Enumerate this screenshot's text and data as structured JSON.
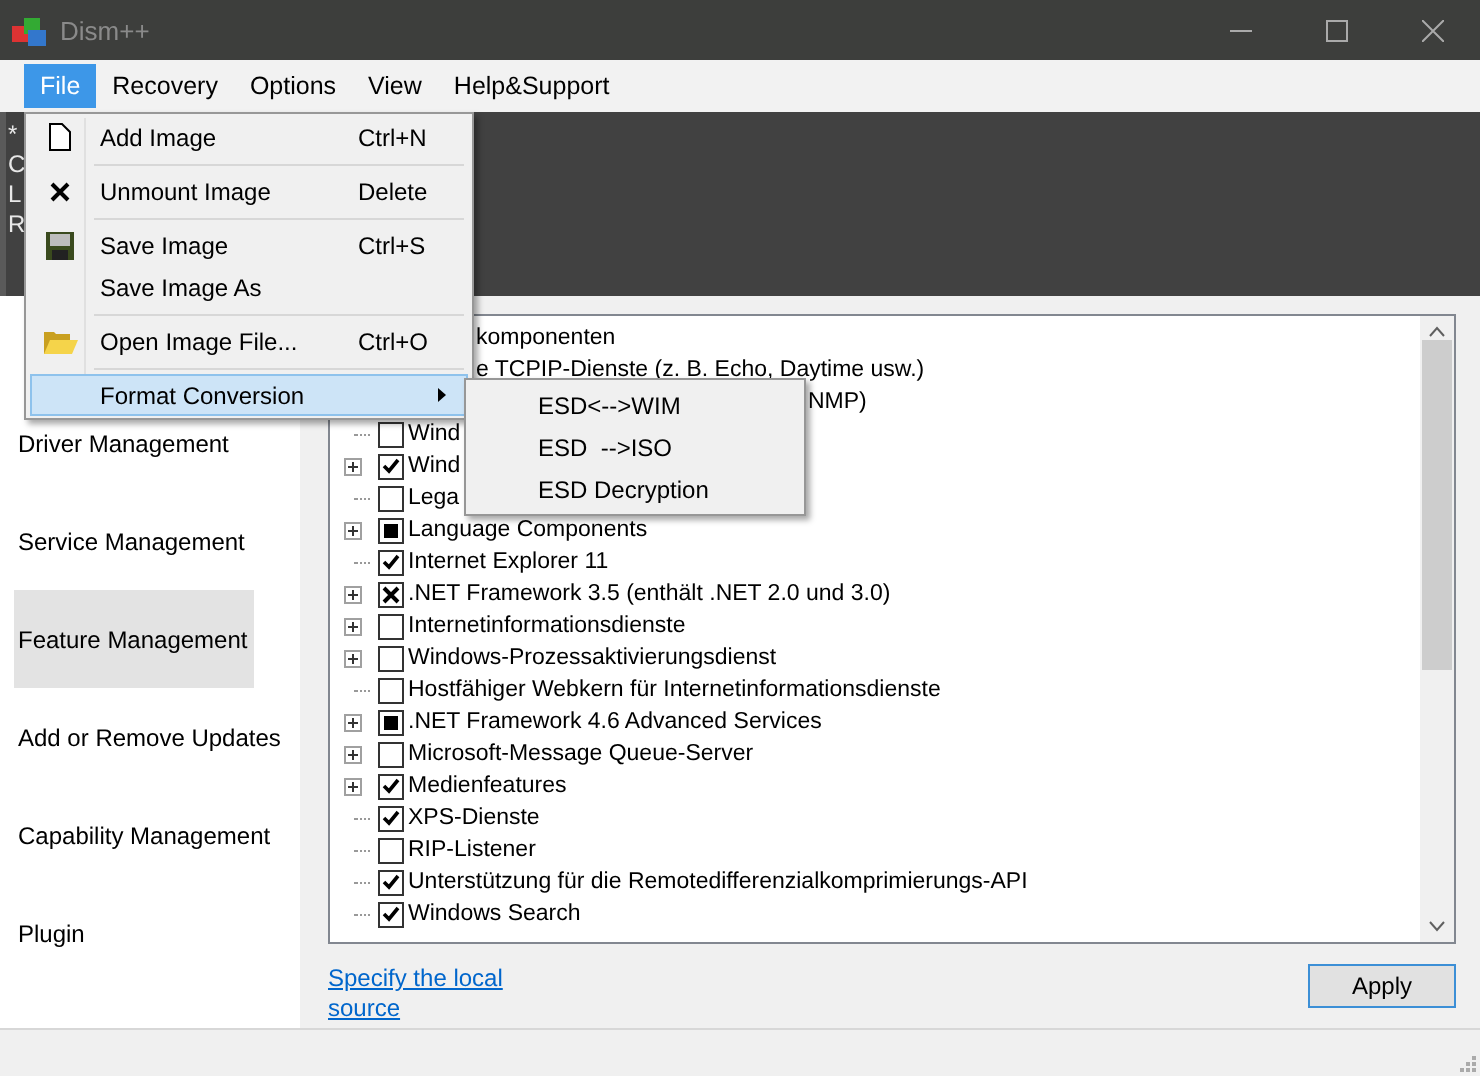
{
  "window": {
    "title": "Dism++"
  },
  "menubar": [
    {
      "label": "File",
      "selected": true
    },
    {
      "label": "Recovery",
      "selected": false
    },
    {
      "label": "Options",
      "selected": false
    },
    {
      "label": "View",
      "selected": false
    },
    {
      "label": "Help&Support",
      "selected": false
    }
  ],
  "header_lines": [
    "*",
    "C",
    "L",
    "R"
  ],
  "sidebar": {
    "items": [
      {
        "label": "Driver Management",
        "selected": false
      },
      {
        "label": "Service Management",
        "selected": false
      },
      {
        "label": "Feature Management",
        "selected": true
      },
      {
        "label": "Add or Remove Updates",
        "selected": false
      },
      {
        "label": "Capability Management",
        "selected": false
      },
      {
        "label": "Plugin",
        "selected": false
      }
    ]
  },
  "features": [
    {
      "kind": "behind-menu",
      "label": "komponenten"
    },
    {
      "kind": "behind-menu",
      "label": "e TCPIP-Dienste (z. B. Echo, Daytime usw.)"
    },
    {
      "kind": "behind-submenu",
      "label": "NMP)"
    },
    {
      "kind": "full",
      "label": "Wind",
      "expandable": false,
      "checked": false,
      "partial": false,
      "excluded": false
    },
    {
      "kind": "full",
      "label": "Wind",
      "expandable": true,
      "checked": true,
      "partial": false,
      "excluded": false
    },
    {
      "kind": "full",
      "label": "Lega",
      "expandable": false,
      "checked": false,
      "partial": false,
      "excluded": false
    },
    {
      "kind": "full",
      "label": "Language Components",
      "expandable": true,
      "checked": false,
      "partial": true,
      "excluded": false
    },
    {
      "kind": "full",
      "label": "Internet Explorer 11",
      "expandable": false,
      "checked": true,
      "partial": false,
      "excluded": false
    },
    {
      "kind": "full",
      "label": ".NET Framework 3.5 (enthält .NET 2.0 und 3.0)",
      "expandable": true,
      "checked": false,
      "partial": false,
      "excluded": true
    },
    {
      "kind": "full",
      "label": "Internetinformationsdienste",
      "expandable": true,
      "checked": false,
      "partial": false,
      "excluded": false
    },
    {
      "kind": "full",
      "label": "Windows-Prozessaktivierungsdienst",
      "expandable": true,
      "checked": false,
      "partial": false,
      "excluded": false
    },
    {
      "kind": "full",
      "label": "Hostfähiger Webkern für Internetinformationsdienste",
      "expandable": false,
      "checked": false,
      "partial": false,
      "excluded": false
    },
    {
      "kind": "full",
      "label": ".NET Framework 4.6 Advanced Services",
      "expandable": true,
      "checked": false,
      "partial": true,
      "excluded": false
    },
    {
      "kind": "full",
      "label": "Microsoft-Message Queue-Server",
      "expandable": true,
      "checked": false,
      "partial": false,
      "excluded": false
    },
    {
      "kind": "full",
      "label": "Medienfeatures",
      "expandable": true,
      "checked": true,
      "partial": false,
      "excluded": false
    },
    {
      "kind": "full",
      "label": "XPS-Dienste",
      "expandable": false,
      "checked": true,
      "partial": false,
      "excluded": false
    },
    {
      "kind": "full",
      "label": "RIP-Listener",
      "expandable": false,
      "checked": false,
      "partial": false,
      "excluded": false
    },
    {
      "kind": "full",
      "label": "Unterstützung für die Remotedifferenzialkomprimierungs-API",
      "expandable": false,
      "checked": true,
      "partial": false,
      "excluded": false
    },
    {
      "kind": "full",
      "label": "Windows Search",
      "expandable": false,
      "checked": true,
      "partial": false,
      "excluded": false
    }
  ],
  "source_link": "Specify the local source",
  "apply_button": "Apply",
  "file_menu": [
    {
      "kind": "item",
      "label": "Add Image",
      "shortcut": "Ctrl+N",
      "selected": false
    },
    {
      "kind": "separator"
    },
    {
      "kind": "item",
      "label": "Unmount Image",
      "shortcut": "Delete",
      "selected": false
    },
    {
      "kind": "separator"
    },
    {
      "kind": "item",
      "label": "Save Image",
      "shortcut": "Ctrl+S",
      "selected": false
    },
    {
      "kind": "item",
      "label": "Save Image As",
      "selected": false
    },
    {
      "kind": "separator"
    },
    {
      "kind": "item",
      "label": "Open Image File...",
      "shortcut": "Ctrl+O",
      "selected": false
    },
    {
      "kind": "separator"
    },
    {
      "kind": "item",
      "label": "Format Conversion",
      "submenu": true,
      "selected": true
    }
  ],
  "submenu": [
    {
      "label": "ESD<-->WIM"
    },
    {
      "label": "ESD  -->ISO"
    },
    {
      "label": "ESD Decryption"
    }
  ]
}
